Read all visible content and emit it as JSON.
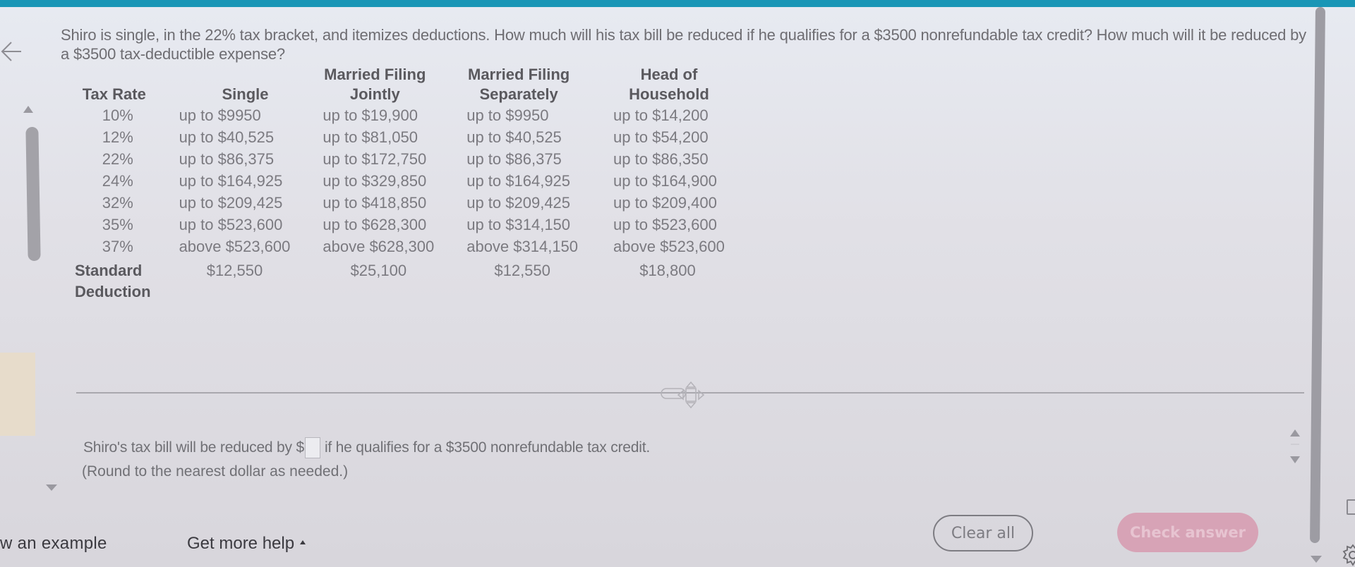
{
  "question": {
    "text": "Shiro is single, in the 22% tax bracket, and itemizes deductions. How much will his tax bill be reduced if he qualifies for a $3500 nonrefundable tax credit? How much will it be reduced by a $3500 tax-deductible expense?"
  },
  "table": {
    "headers": [
      "Tax Rate",
      "Single",
      "Married Filing Jointly",
      "Married Filing Separately",
      "Head of Household"
    ],
    "header_lines": [
      [
        "",
        "Tax Rate"
      ],
      [
        "",
        "Single"
      ],
      [
        "Married Filing",
        "Jointly"
      ],
      [
        "Married Filing",
        "Separately"
      ],
      [
        "Head of",
        "Household"
      ]
    ],
    "rows": [
      {
        "rate": "10%",
        "single": "up to $9950",
        "mfj": "up to $19,900",
        "mfs": "up to $9950",
        "hoh": "up to $14,200"
      },
      {
        "rate": "12%",
        "single": "up to $40,525",
        "mfj": "up to $81,050",
        "mfs": "up to $40,525",
        "hoh": "up to $54,200"
      },
      {
        "rate": "22%",
        "single": "up to $86,375",
        "mfj": "up to $172,750",
        "mfs": "up to $86,375",
        "hoh": "up to $86,350"
      },
      {
        "rate": "24%",
        "single": "up to $164,925",
        "mfj": "up to $329,850",
        "mfs": "up to $164,925",
        "hoh": "up to $164,900"
      },
      {
        "rate": "32%",
        "single": "up to $209,425",
        "mfj": "up to $418,850",
        "mfs": "up to $209,425",
        "hoh": "up to $209,400"
      },
      {
        "rate": "35%",
        "single": "up to $523,600",
        "mfj": "up to $628,300",
        "mfs": "up to $314,150",
        "hoh": "up to $523,600"
      },
      {
        "rate": "37%",
        "single": "above $523,600",
        "mfj": "above $628,300",
        "mfs": "above $314,150",
        "hoh": "above $523,600"
      }
    ],
    "standard_deduction": {
      "label_line1": "Standard",
      "label_line2": "Deduction",
      "single": "$12,550",
      "mfj": "$25,100",
      "mfs": "$12,550",
      "hoh": "$18,800"
    }
  },
  "answer": {
    "prefix": "Shiro's tax bill will be reduced by $",
    "input_value": "",
    "suffix": "if he qualifies for a $3500 nonrefundable tax credit.",
    "note": "(Round to the nearest dollar as needed.)"
  },
  "footer": {
    "view_example": "w an example",
    "get_more_help": "Get more help",
    "clear_all": "Clear all",
    "check_answer": "Check answer"
  },
  "icons": {
    "back": "arrow-left-icon",
    "drag": "move-handle-icon",
    "settings": "gear-icon"
  },
  "colors": {
    "top_bar": "#1996b6",
    "check_answer_bg": "#d7a3b6",
    "scrollbar": "#a3a2a8"
  }
}
